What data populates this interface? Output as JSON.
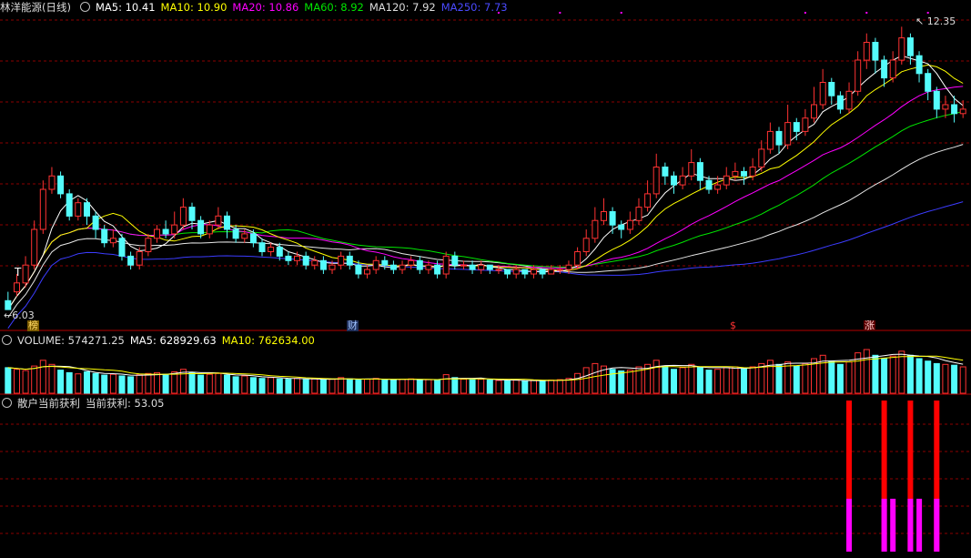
{
  "header_main": {
    "title": "林洋能源(日线)",
    "ma5_label": "MA5: 10.41",
    "ma10_label": "MA10: 10.90",
    "ma20_label": "MA20: 10.86",
    "ma60_label": "MA60: 8.92",
    "ma120_label": "MA120: 7.92",
    "ma250_label": "MA250: 7.73"
  },
  "header_volume": {
    "volume_label": "VOLUME: 574271.25",
    "ma5_label": "MA5: 628929.63",
    "ma10_label": "MA10: 762634.00"
  },
  "header_indicator": {
    "name": "散户当前获利",
    "value_label": "当前获利: 53.05"
  },
  "annotations": {
    "high_label": "12.35",
    "low_label": "6.03",
    "t_marker": "T",
    "tag_1": "榜",
    "tag_2": "财",
    "tag_3": "$",
    "tag_4": "涨"
  },
  "colors": {
    "up": "#ff3232",
    "down": "#54fcfc",
    "ma5": "#ffffff",
    "ma10": "#ffff00",
    "ma20": "#ff00ff",
    "ma60": "#00e600",
    "ma120": "#e8e8e8",
    "ma250": "#3c3cff",
    "grid": "#8b0000",
    "indicator_magenta": "#ff00ff",
    "indicator_red": "#ff0000"
  },
  "chart_data": {
    "type": "candlestick",
    "price_axis": {
      "min": 6.03,
      "max": 12.35
    },
    "candles": [
      [
        6.2,
        6.0,
        6.4,
        6.0
      ],
      [
        6.4,
        6.6,
        6.8,
        6.3
      ],
      [
        6.6,
        7.0,
        7.2,
        6.5
      ],
      [
        7.0,
        7.8,
        8.0,
        6.9
      ],
      [
        7.8,
        8.7,
        8.9,
        7.7
      ],
      [
        8.7,
        9.0,
        9.2,
        8.6
      ],
      [
        9.0,
        8.6,
        9.1,
        8.5
      ],
      [
        8.6,
        8.1,
        8.7,
        8.0
      ],
      [
        8.1,
        8.4,
        8.5,
        8.0
      ],
      [
        8.4,
        8.1,
        8.5,
        7.9
      ],
      [
        8.1,
        7.8,
        8.2,
        7.6
      ],
      [
        7.8,
        7.5,
        7.9,
        7.4
      ],
      [
        7.5,
        7.6,
        7.8,
        7.4
      ],
      [
        7.6,
        7.2,
        7.7,
        7.1
      ],
      [
        7.2,
        7.0,
        7.3,
        6.9
      ],
      [
        7.0,
        7.3,
        7.4,
        6.9
      ],
      [
        7.3,
        7.6,
        7.7,
        7.2
      ],
      [
        7.6,
        7.8,
        7.9,
        7.5
      ],
      [
        7.8,
        7.7,
        8.0,
        7.6
      ],
      [
        7.7,
        7.9,
        8.2,
        7.6
      ],
      [
        7.9,
        8.3,
        8.5,
        7.8
      ],
      [
        8.3,
        8.0,
        8.4,
        7.8
      ],
      [
        8.0,
        7.7,
        8.1,
        7.6
      ],
      [
        7.7,
        7.9,
        8.0,
        7.6
      ],
      [
        7.9,
        8.1,
        8.3,
        7.8
      ],
      [
        8.1,
        7.8,
        8.2,
        7.6
      ],
      [
        7.8,
        7.6,
        7.9,
        7.5
      ],
      [
        7.6,
        7.7,
        7.8,
        7.5
      ],
      [
        7.7,
        7.5,
        7.8,
        7.4
      ],
      [
        7.5,
        7.3,
        7.6,
        7.2
      ],
      [
        7.3,
        7.4,
        7.5,
        7.2
      ],
      [
        7.4,
        7.2,
        7.5,
        7.1
      ],
      [
        7.2,
        7.1,
        7.3,
        7.0
      ],
      [
        7.1,
        7.2,
        7.3,
        7.0
      ],
      [
        7.2,
        7.0,
        7.3,
        6.9
      ],
      [
        7.0,
        7.1,
        7.2,
        6.9
      ],
      [
        7.1,
        6.9,
        7.2,
        6.8
      ],
      [
        6.9,
        7.0,
        7.1,
        6.8
      ],
      [
        7.0,
        7.2,
        7.3,
        6.9
      ],
      [
        7.2,
        7.0,
        7.3,
        6.9
      ],
      [
        7.0,
        6.8,
        7.1,
        6.7
      ],
      [
        6.8,
        6.9,
        7.0,
        6.7
      ],
      [
        6.9,
        7.1,
        7.2,
        6.8
      ],
      [
        7.1,
        7.0,
        7.2,
        6.9
      ],
      [
        7.0,
        6.9,
        7.1,
        6.8
      ],
      [
        6.9,
        7.0,
        7.1,
        6.8
      ],
      [
        7.0,
        7.1,
        7.2,
        6.9
      ],
      [
        7.1,
        6.9,
        7.2,
        6.8
      ],
      [
        6.9,
        7.0,
        7.1,
        6.8
      ],
      [
        7.0,
        6.8,
        7.1,
        6.7
      ],
      [
        6.8,
        7.2,
        7.3,
        6.7
      ],
      [
        7.2,
        7.0,
        7.3,
        6.9
      ],
      [
        7.0,
        7.0,
        7.1,
        6.9
      ],
      [
        7.0,
        6.9,
        7.1,
        6.8
      ],
      [
        6.9,
        7.0,
        7.1,
        6.8
      ],
      [
        7.0,
        6.9,
        7.0,
        6.8
      ],
      [
        6.9,
        6.9,
        7.0,
        6.8
      ],
      [
        6.9,
        6.8,
        6.9,
        6.7
      ],
      [
        6.8,
        6.9,
        7.0,
        6.7
      ],
      [
        6.9,
        6.8,
        6.9,
        6.7
      ],
      [
        6.8,
        6.9,
        7.0,
        6.7
      ],
      [
        6.9,
        6.8,
        6.9,
        6.7
      ],
      [
        6.8,
        6.9,
        7.0,
        6.8
      ],
      [
        6.9,
        6.9,
        7.0,
        6.8
      ],
      [
        6.9,
        7.0,
        7.1,
        6.8
      ],
      [
        7.0,
        7.3,
        7.4,
        6.9
      ],
      [
        7.3,
        7.6,
        7.8,
        7.2
      ],
      [
        7.6,
        8.0,
        8.3,
        7.5
      ],
      [
        8.0,
        8.2,
        8.5,
        7.9
      ],
      [
        8.2,
        7.9,
        8.3,
        7.7
      ],
      [
        7.9,
        7.8,
        8.0,
        7.6
      ],
      [
        7.8,
        8.0,
        8.2,
        7.7
      ],
      [
        8.0,
        8.3,
        8.5,
        7.9
      ],
      [
        8.3,
        8.6,
        8.9,
        8.2
      ],
      [
        8.6,
        9.2,
        9.5,
        8.5
      ],
      [
        9.2,
        9.0,
        9.3,
        8.8
      ],
      [
        9.0,
        8.8,
        9.1,
        8.6
      ],
      [
        8.8,
        9.0,
        9.2,
        8.7
      ],
      [
        9.0,
        9.3,
        9.6,
        8.9
      ],
      [
        9.3,
        8.9,
        9.4,
        8.7
      ],
      [
        8.9,
        8.7,
        9.0,
        8.6
      ],
      [
        8.7,
        8.8,
        9.0,
        8.6
      ],
      [
        8.8,
        9.0,
        9.2,
        8.7
      ],
      [
        9.0,
        9.1,
        9.3,
        8.9
      ],
      [
        9.1,
        9.0,
        9.2,
        8.8
      ],
      [
        9.0,
        9.2,
        9.4,
        8.9
      ],
      [
        9.2,
        9.6,
        9.8,
        9.1
      ],
      [
        9.6,
        10.0,
        10.2,
        9.5
      ],
      [
        10.0,
        9.7,
        10.1,
        9.5
      ],
      [
        9.7,
        10.2,
        10.6,
        9.6
      ],
      [
        10.2,
        10.0,
        10.3,
        9.8
      ],
      [
        10.0,
        10.3,
        10.5,
        9.9
      ],
      [
        10.3,
        10.6,
        11.0,
        10.2
      ],
      [
        10.6,
        11.1,
        11.4,
        10.5
      ],
      [
        11.1,
        10.8,
        11.2,
        10.6
      ],
      [
        10.8,
        10.5,
        10.9,
        10.4
      ],
      [
        10.5,
        10.9,
        11.1,
        10.4
      ],
      [
        10.9,
        11.6,
        11.8,
        10.8
      ],
      [
        11.6,
        12.0,
        12.2,
        11.4
      ],
      [
        12.0,
        11.6,
        12.1,
        11.3
      ],
      [
        11.6,
        11.2,
        11.7,
        11.0
      ],
      [
        11.2,
        11.6,
        11.8,
        11.1
      ],
      [
        11.6,
        12.1,
        12.35,
        11.5
      ],
      [
        12.1,
        11.7,
        12.2,
        11.5
      ],
      [
        11.7,
        11.3,
        11.8,
        11.1
      ],
      [
        11.3,
        10.9,
        11.4,
        10.7
      ],
      [
        10.9,
        10.5,
        11.0,
        10.3
      ],
      [
        10.5,
        10.6,
        10.8,
        10.3
      ],
      [
        10.6,
        10.4,
        10.8,
        10.2
      ],
      [
        10.4,
        10.5,
        10.7,
        10.3
      ]
    ],
    "volume": [
      62,
      58,
      55,
      66,
      80,
      70,
      56,
      50,
      47,
      52,
      48,
      44,
      46,
      42,
      40,
      45,
      48,
      50,
      46,
      52,
      58,
      50,
      44,
      46,
      48,
      44,
      40,
      42,
      38,
      36,
      38,
      35,
      34,
      36,
      33,
      35,
      32,
      34,
      38,
      35,
      32,
      34,
      36,
      33,
      32,
      34,
      35,
      32,
      33,
      31,
      45,
      38,
      34,
      33,
      34,
      32,
      31,
      30,
      32,
      30,
      31,
      30,
      32,
      33,
      36,
      48,
      62,
      72,
      66,
      58,
      54,
      56,
      64,
      70,
      80,
      66,
      58,
      62,
      70,
      64,
      56,
      58,
      62,
      64,
      60,
      64,
      72,
      80,
      70,
      76,
      66,
      72,
      84,
      92,
      78,
      70,
      76,
      98,
      106,
      92,
      84,
      90,
      102,
      92,
      84,
      78,
      72,
      70,
      68,
      64
    ],
    "indicator": {
      "magenta_bars": [
        [
          96,
          35
        ],
        [
          100,
          35
        ],
        [
          101,
          35
        ],
        [
          103,
          35
        ],
        [
          104,
          35
        ],
        [
          106,
          35
        ]
      ],
      "red_bars": [
        [
          96,
          100
        ],
        [
          100,
          100
        ],
        [
          103,
          100
        ],
        [
          106,
          100
        ]
      ]
    }
  }
}
